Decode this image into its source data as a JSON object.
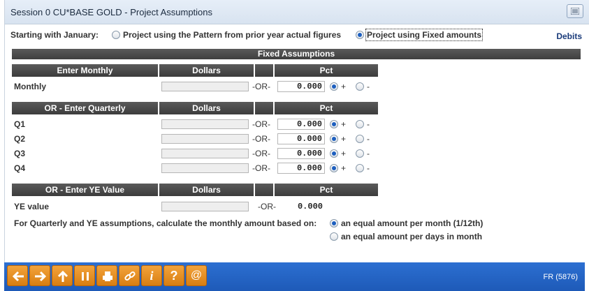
{
  "window": {
    "title": "Session 0 CU*BASE GOLD - Project Assumptions"
  },
  "options": {
    "starting_label": "Starting with January:",
    "pattern_label": "Project using the Pattern from prior year actual figures",
    "fixed_label": "Project using Fixed amounts",
    "selected": "fixed",
    "debits_label": "Debits"
  },
  "section": {
    "title": "Fixed Assumptions"
  },
  "monthly": {
    "header": {
      "label": "Enter Monthly",
      "dollars": "Dollars",
      "pct": "Pct"
    },
    "row": {
      "label": "Monthly",
      "dollars": "",
      "or": "-OR-",
      "pct": "0.000",
      "plus": "+",
      "minus": "-",
      "sign": "plus"
    }
  },
  "quarterly": {
    "header": {
      "label": "OR - Enter Quarterly",
      "dollars": "Dollars",
      "pct": "Pct"
    },
    "rows": [
      {
        "label": "Q1",
        "dollars": "",
        "or": "-OR-",
        "pct": "0.000",
        "plus": "+",
        "minus": "-",
        "sign": "plus"
      },
      {
        "label": "Q2",
        "dollars": "",
        "or": "-OR-",
        "pct": "0.000",
        "plus": "+",
        "minus": "-",
        "sign": "plus"
      },
      {
        "label": "Q3",
        "dollars": "",
        "or": "-OR-",
        "pct": "0.000",
        "plus": "+",
        "minus": "-",
        "sign": "plus"
      },
      {
        "label": "Q4",
        "dollars": "",
        "or": "-OR-",
        "pct": "0.000",
        "plus": "+",
        "minus": "-",
        "sign": "plus"
      }
    ]
  },
  "ye": {
    "header": {
      "label": "OR - Enter YE Value",
      "dollars": "Dollars",
      "pct": "Pct"
    },
    "row": {
      "label": "YE value",
      "dollars": "",
      "or": "-OR-",
      "pct": "0.000"
    }
  },
  "calc": {
    "label": "For Quarterly and YE assumptions, calculate the monthly amount based on:",
    "option1": "an equal amount per month (1/12th)",
    "option2": "an equal amount per days in month",
    "selected": "option1"
  },
  "toolbar": {
    "buttons": [
      "back-arrow-icon",
      "forward-arrow-icon",
      "up-arrow-icon",
      "pause-icon",
      "print-icon",
      "link-icon",
      "info-icon",
      "help-icon",
      "at-icon"
    ],
    "info_glyph": "i",
    "help_glyph": "?",
    "at_glyph": "@",
    "code": "FR (5876)"
  }
}
